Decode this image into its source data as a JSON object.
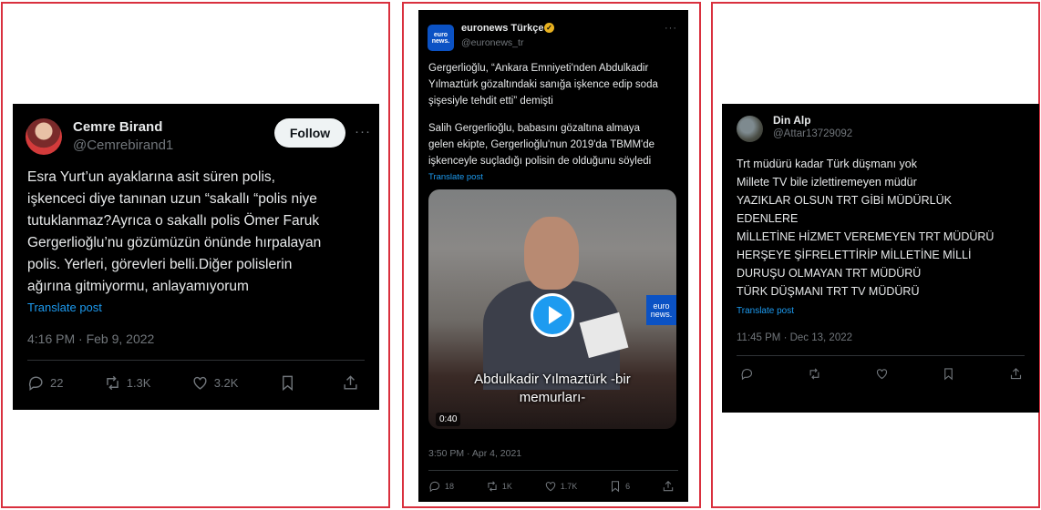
{
  "post1": {
    "name": "Cemre Birand",
    "handle": "@Cemrebirand1",
    "follow_label": "Follow",
    "more": "···",
    "lines": [
      "Esra Yurt’un ayaklarına asit süren polis,",
      "işkenceci diye tanınan uzun “sakallı “polis niye",
      "tutuklanmaz?Ayrıca o sakallı polis Ömer Faruk",
      "Gergerlioğlu’nu gözümüzün önünde hırpalayan",
      "polis. Yerleri, görevleri belli.Diğer polislerin",
      "ağırına gitmiyormu, anlayamıyorum"
    ],
    "translate": "Translate post",
    "timestamp": "4:16 PM · Feb 9, 2022",
    "replies": "22",
    "reposts": "1.3K",
    "likes": "3.2K"
  },
  "post2": {
    "logo_text": "euro news.",
    "name": "euronews Türkçe",
    "handle": "@euronews_tr",
    "more": "···",
    "lines": [
      "Gergerlioğlu, “Ankara Emniyeti'nden Abdulkadir",
      "Yılmaztürk gözaltındaki sanığa işkence edip soda",
      "şişesiyle tehdit etti” demişti",
      "",
      "Salih Gergerlioğlu, babasını gözaltına almaya",
      "gelen ekipte, Gergerlioğlu'nun 2019'da TBMM'de",
      "işkenceyle suçladığı polisin de olduğunu söyledi"
    ],
    "translate": "Translate post",
    "video": {
      "logo_text": "euro news.",
      "subtitle_line1": "Abdulkadir Yılmaztürk -bir",
      "subtitle_line2": "memurları-",
      "duration": "0:40"
    },
    "timestamp": "3:50 PM · Apr 4, 2021",
    "replies": "18",
    "reposts": "1K",
    "likes": "1.7K",
    "bookmarks": "6"
  },
  "post3": {
    "name": "Din Alp",
    "handle": "@Attar13729092",
    "lines": [
      "Trt müdürü kadar Türk düşmanı yok",
      "Millete TV bile izlettiremeyen müdür",
      "YAZIKLAR OLSUN TRT GİBİ MÜDÜRLÜK",
      "EDENLERE",
      "MİLLETİNE HİZMET VEREMEYEN TRT MÜDÜRÜ",
      "HERŞEYE ŞİFRELETTİRİP MİLLETİNE MİLLİ",
      "DURUŞU OLMAYAN TRT MÜDÜRÜ",
      "TÜRK DÜŞMANI TRT TV MÜDÜRÜ"
    ],
    "translate": "Translate post",
    "timestamp": "11:45 PM · Dec 13, 2022"
  },
  "colors": {
    "border": "#d9303e",
    "card_bg": "#000000",
    "text": "#e7e9ea",
    "muted": "#71767b",
    "link": "#1d9bf0"
  }
}
